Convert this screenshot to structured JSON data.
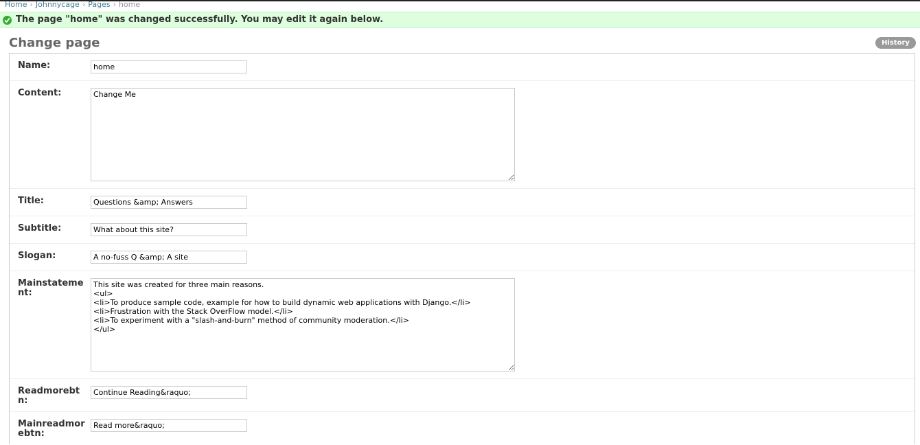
{
  "breadcrumbs": [
    {
      "label": "Home"
    },
    {
      "label": "Johnnycage"
    },
    {
      "label": "Pages"
    },
    {
      "label": "home"
    }
  ],
  "breadcrumb_separator": "›",
  "message": {
    "text": "The page \"home\" was changed successfully. You may edit it again below.",
    "icon": "success-check-icon",
    "color": "#33aa33"
  },
  "page": {
    "title": "Change page",
    "history_label": "History"
  },
  "fields": {
    "name": {
      "label": "Name:",
      "value": "home"
    },
    "content": {
      "label": "Content:",
      "value": "Change Me"
    },
    "title": {
      "label": "Title:",
      "value": "Questions &amp; Answers"
    },
    "subtitle": {
      "label": "Subtitle:",
      "value": "What about this site?"
    },
    "slogan": {
      "label": "Slogan:",
      "value": "A no-fuss Q &amp; A site"
    },
    "mainstatement": {
      "label": "Mainstatement:",
      "value": "This site was created for three main reasons.\n<ul>\n<li>To produce sample code, example for how to build dynamic web applications with Django.</li>\n<li>Frustration with the Stack OverFlow model.</li>\n<li>To experiment with a \"slash-and-burn\" method of community moderation.</li>\n</ul>"
    },
    "readmorebtn": {
      "label": "Readmorebtn:",
      "value": "Continue Reading&raquo;"
    },
    "mainreadmorebtn": {
      "label": "Mainreadmorebtn:",
      "value": "Read more&raquo;"
    }
  }
}
